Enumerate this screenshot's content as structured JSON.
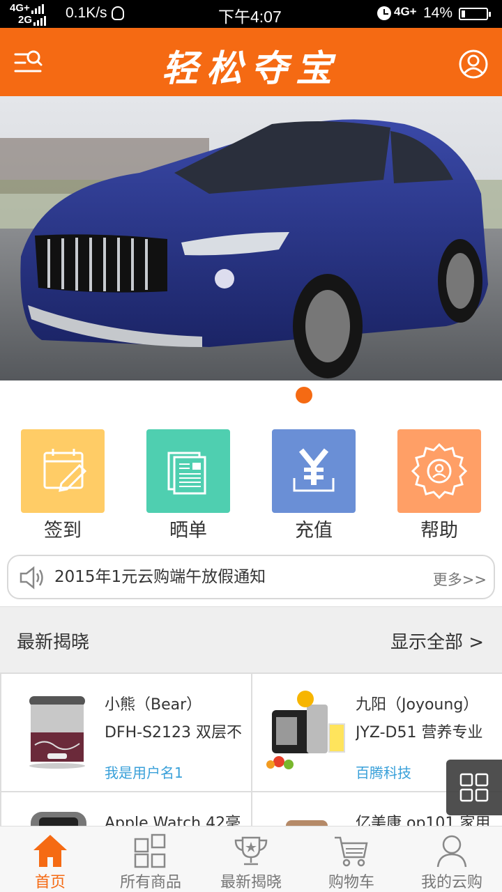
{
  "status_bar": {
    "network_top": "4G+",
    "network_bottom": "2G",
    "speed": "0.1K/s",
    "time": "下午4:07",
    "network_right": "4G+",
    "battery": "14%"
  },
  "header": {
    "title": "轻松夺宝"
  },
  "banner": {
    "page_count": 1,
    "active_page": 1
  },
  "quick_entries": [
    {
      "label": "签到",
      "color": "#ffcc66",
      "icon": "calendar-edit-icon"
    },
    {
      "label": "晒单",
      "color": "#4fcfb0",
      "icon": "document-icon"
    },
    {
      "label": "充值",
      "color": "#6a8fd6",
      "icon": "yuan-icon"
    },
    {
      "label": "帮助",
      "color": "#ff9f66",
      "icon": "help-badge-icon"
    }
  ],
  "notice": {
    "text": "2015年1元云购端午放假通知",
    "more": "更多>>"
  },
  "latest": {
    "title": "最新揭晓",
    "show_all": "显示全部 >"
  },
  "products": [
    {
      "name_line1": "小熊（Bear）",
      "name_line2": "DFH-S2123 双层不",
      "user": "我是用户名1"
    },
    {
      "name_line1": "九阳（Joyoung）",
      "name_line2": "JYZ-D51 营养专业",
      "user": "百腾科技"
    },
    {
      "name_line1": "Apple Watch 42毫",
      "name_line2": "",
      "user": ""
    },
    {
      "name_line1": "亿美康 op101 家用",
      "name_line2": "",
      "user": ""
    }
  ],
  "bottom_nav": [
    {
      "label": "首页",
      "icon": "home-icon",
      "active": true
    },
    {
      "label": "所有商品",
      "icon": "grid-icon",
      "active": false
    },
    {
      "label": "最新揭晓",
      "icon": "trophy-icon",
      "active": false
    },
    {
      "label": "购物车",
      "icon": "cart-icon",
      "active": false
    },
    {
      "label": "我的云购",
      "icon": "person-icon",
      "active": false
    }
  ],
  "colors": {
    "brand": "#f56a13",
    "link": "#39a0d9"
  }
}
